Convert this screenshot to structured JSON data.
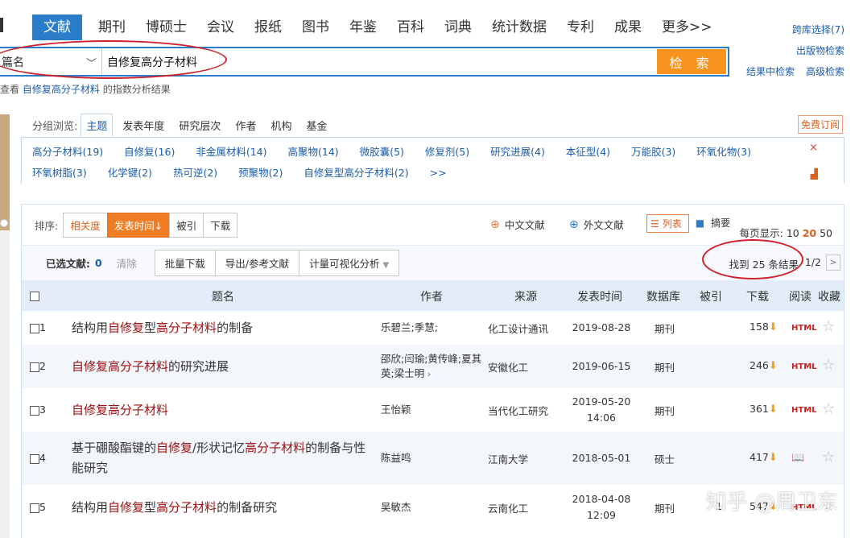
{
  "nav": {
    "items": [
      "文献",
      "期刊",
      "博硕士",
      "会议",
      "报纸",
      "图书",
      "年鉴",
      "百科",
      "词典",
      "统计数据",
      "专利",
      "成果",
      "更多>>"
    ],
    "active_index": 0
  },
  "right_links": {
    "cross_db": "跨库选择(7)",
    "publication_search": "出版物检索",
    "search_in_results": "结果中检索",
    "advanced_search": "高级检索"
  },
  "search": {
    "field": "篇名",
    "query": "自修复高分子材料",
    "button": "检 索"
  },
  "hint": {
    "prefix": "查看",
    "term": "自修复高分子材料",
    "suffix": "的指数分析结果"
  },
  "group": {
    "label": "分组浏览:",
    "tabs": [
      "主题",
      "发表年度",
      "研究层次",
      "作者",
      "机构",
      "基金"
    ],
    "subscribe": "免费订阅",
    "topics": [
      "高分子材料(19)",
      "自修复(16)",
      "非金属材料(14)",
      "高聚物(14)",
      "微胶囊(5)",
      "修复剂(5)",
      "研究进展(4)",
      "本征型(4)",
      "万能胶(3)",
      "环氧化物(3)",
      "环氧树脂(3)",
      "化学键(2)",
      "热可逆(2)",
      "预聚物(2)",
      "自修复型高分子材料(2)",
      ">>"
    ]
  },
  "sortbar": {
    "label": "排序:",
    "relevance": "相关度",
    "pub_time": "发表时间",
    "cited": "被引",
    "downloads": "下载",
    "chinese": "中文文献",
    "foreign": "外文文献",
    "list": "列表",
    "abstract": "摘要",
    "per_page_label": "每页显示:",
    "per_page_options": [
      "10",
      "20",
      "50"
    ],
    "per_page_current": "20"
  },
  "selbar": {
    "selected_label": "已选文献:",
    "selected_count": "0",
    "clear": "清除",
    "batch_download": "批量下载",
    "export": "导出/参考文献",
    "visual": "计量可视化分析",
    "found": "找到 25 条结果",
    "page": "1/2"
  },
  "table": {
    "headers": {
      "title": "题名",
      "author": "作者",
      "source": "来源",
      "date": "发表时间",
      "db": "数据库",
      "cited": "被引",
      "downloads": "下载",
      "read": "阅读",
      "fav": "收藏"
    },
    "rows": [
      {
        "no": "1",
        "title_parts": [
          [
            "结构用",
            false
          ],
          [
            "自修复",
            true
          ],
          [
            "型",
            false
          ],
          [
            "高分子材料",
            true
          ],
          [
            "的制备",
            false
          ]
        ],
        "authors": "乐碧兰;季慧;",
        "source": "化工设计通讯",
        "date": "2019-08-28",
        "db": "期刊",
        "downloads": "158",
        "read": "HTML"
      },
      {
        "no": "2",
        "title_parts": [
          [
            "自修复高分子材料",
            true
          ],
          [
            "的研究进展",
            false
          ]
        ],
        "authors": "邵欣;闫瑜;黄传峰;夏其英;梁士明",
        "source": "安徽化工",
        "date": "2019-06-15",
        "db": "期刊",
        "downloads": "246",
        "read": "HTML"
      },
      {
        "no": "3",
        "title_parts": [
          [
            "自修复高分子材料",
            true
          ]
        ],
        "authors": "王怡颖",
        "source": "当代化工研究",
        "date": "2019-05-20 14:06",
        "db": "期刊",
        "downloads": "361",
        "read": "HTML"
      },
      {
        "no": "4",
        "title_parts": [
          [
            "基于硼酸酯键的",
            false
          ],
          [
            "自修复",
            true
          ],
          [
            "/形状记忆",
            false
          ],
          [
            "高分子材料",
            true
          ],
          [
            "的制备与性能研究",
            false
          ]
        ],
        "authors": "陈益鸣",
        "source": "江南大学",
        "date": "2018-05-01",
        "db": "硕士",
        "downloads": "417",
        "read": "book"
      },
      {
        "no": "5",
        "title_parts": [
          [
            "结构用",
            false
          ],
          [
            "自修复",
            true
          ],
          [
            "型",
            false
          ],
          [
            "高分子材料",
            true
          ],
          [
            "的制备研究",
            false
          ]
        ],
        "authors": "吴敏杰",
        "source": "云南化工",
        "date": "2018-04-08 12:09",
        "db": "期刊",
        "cited": "1",
        "downloads": "547",
        "read": "HTML"
      }
    ]
  },
  "watermark": "知乎 @周卫东",
  "colors": {
    "primary": "#2b7dc9",
    "accent": "#f07c24",
    "highlight": "#a01010",
    "annotation": "#d0202a"
  }
}
